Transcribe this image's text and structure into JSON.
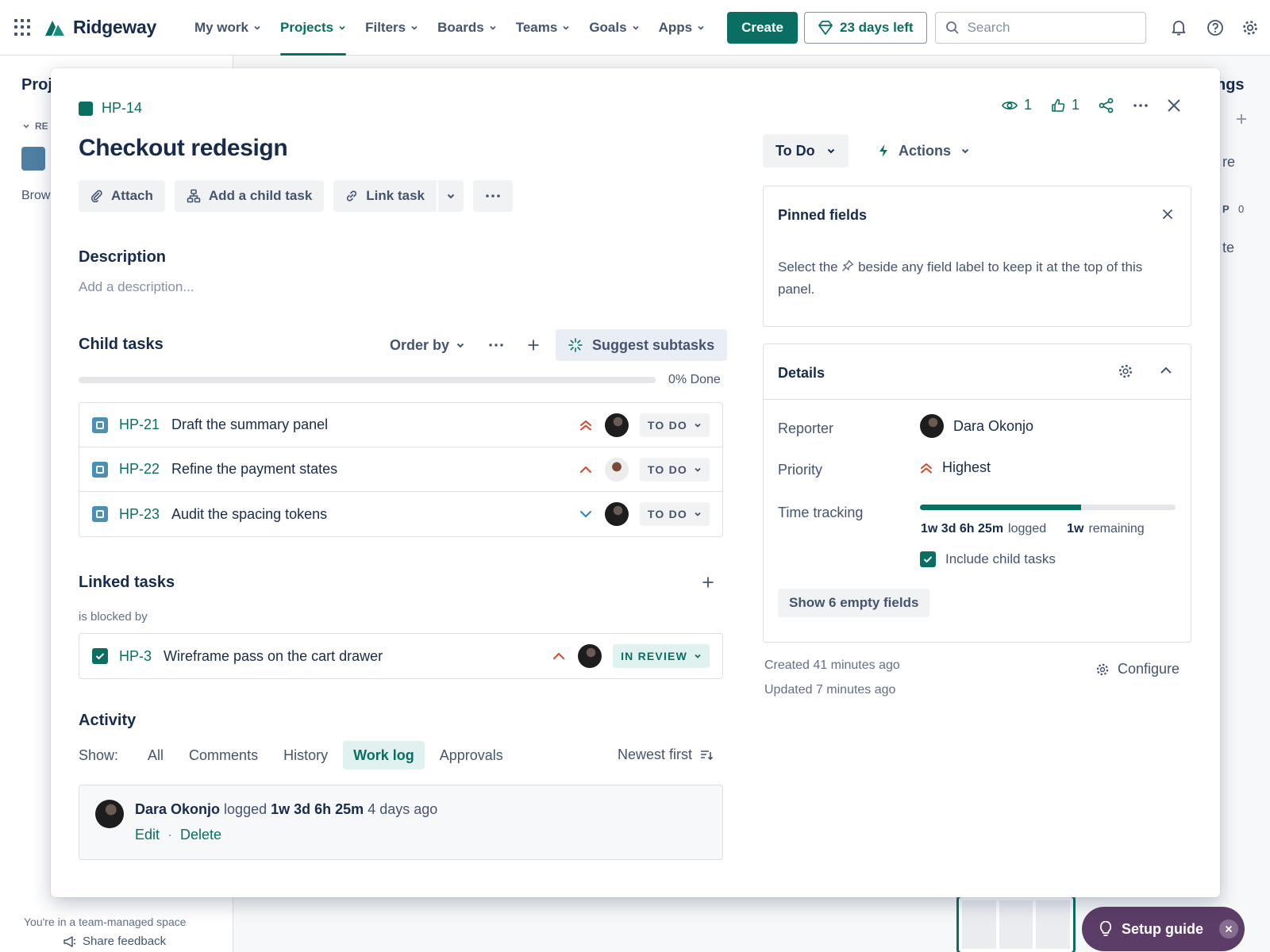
{
  "app": {
    "name": "Ridgeway"
  },
  "nav": {
    "items": [
      {
        "label": "My work"
      },
      {
        "label": "Projects"
      },
      {
        "label": "Filters"
      },
      {
        "label": "Boards"
      },
      {
        "label": "Teams"
      },
      {
        "label": "Goals"
      },
      {
        "label": "Apps"
      }
    ],
    "active": "Projects",
    "create_label": "Create",
    "trial_label": "23 days left",
    "search_placeholder": "Search"
  },
  "sidebar": {
    "title": "Proj",
    "section": "RE",
    "browse": "Brow",
    "footer": "You're in a team-managed space",
    "feedback": "Share feedback"
  },
  "behind_right": {
    "t1": "ngs",
    "t2": "re",
    "t3": "P",
    "t4": "0",
    "t5": "te"
  },
  "setup_guide": {
    "label": "Setup guide"
  },
  "issue": {
    "key": "HP-14",
    "title": "Checkout redesign",
    "watchers": "1",
    "votes": "1",
    "status": "To Do",
    "actions_label": "Actions"
  },
  "toolbar": {
    "attach": "Attach",
    "add_child": "Add a child task",
    "link": "Link task"
  },
  "description": {
    "heading": "Description",
    "placeholder": "Add a description..."
  },
  "child_tasks": {
    "heading": "Child tasks",
    "order_by": "Order by",
    "suggest": "Suggest subtasks",
    "progress_label": "0% Done",
    "progress": 0,
    "items": [
      {
        "key": "HP-21",
        "title": "Draft the summary panel",
        "priority": "highest",
        "avatar": "dara",
        "status": "TO DO"
      },
      {
        "key": "HP-22",
        "title": "Refine the payment states",
        "priority": "high",
        "avatar": "other",
        "status": "TO DO"
      },
      {
        "key": "HP-23",
        "title": "Audit the spacing tokens",
        "priority": "low",
        "avatar": "dara",
        "status": "TO DO"
      }
    ]
  },
  "linked_tasks": {
    "heading": "Linked tasks",
    "relation": "is blocked by",
    "items": [
      {
        "key": "HP-3",
        "title": "Wireframe pass on the cart drawer",
        "priority": "high",
        "status": "IN REVIEW"
      }
    ]
  },
  "activity": {
    "heading": "Activity",
    "show_label": "Show:",
    "tabs": [
      "All",
      "Comments",
      "History",
      "Work log",
      "Approvals"
    ],
    "active_tab": "Work log",
    "sort": "Newest first",
    "log": {
      "author": "Dara Okonjo",
      "verb": "logged",
      "amount": "1w 3d 6h 25m",
      "when": "4 days ago",
      "edit": "Edit",
      "sep": "·",
      "delete": "Delete"
    }
  },
  "pinned": {
    "heading": "Pinned fields",
    "body_1": "Select the",
    "body_2": "beside any field label to keep it at the top of this panel."
  },
  "details": {
    "heading": "Details",
    "reporter_label": "Reporter",
    "reporter": "Dara Okonjo",
    "priority_label": "Priority",
    "priority": "Highest",
    "time_label": "Time tracking",
    "logged": "1w 3d 6h 25m",
    "logged_word": "logged",
    "remaining": "1w",
    "remaining_word": "remaining",
    "time_logged_fraction": 0.63,
    "include_child": "Include child tasks",
    "show_empty": "Show 6 empty fields"
  },
  "meta": {
    "created": "Created 41 minutes ago",
    "updated": "Updated 7 minutes ago",
    "configure": "Configure"
  },
  "colors": {
    "accent": "#0b6e62",
    "priority_red": "#d9472b",
    "setup_bg": "#5c3d67"
  }
}
